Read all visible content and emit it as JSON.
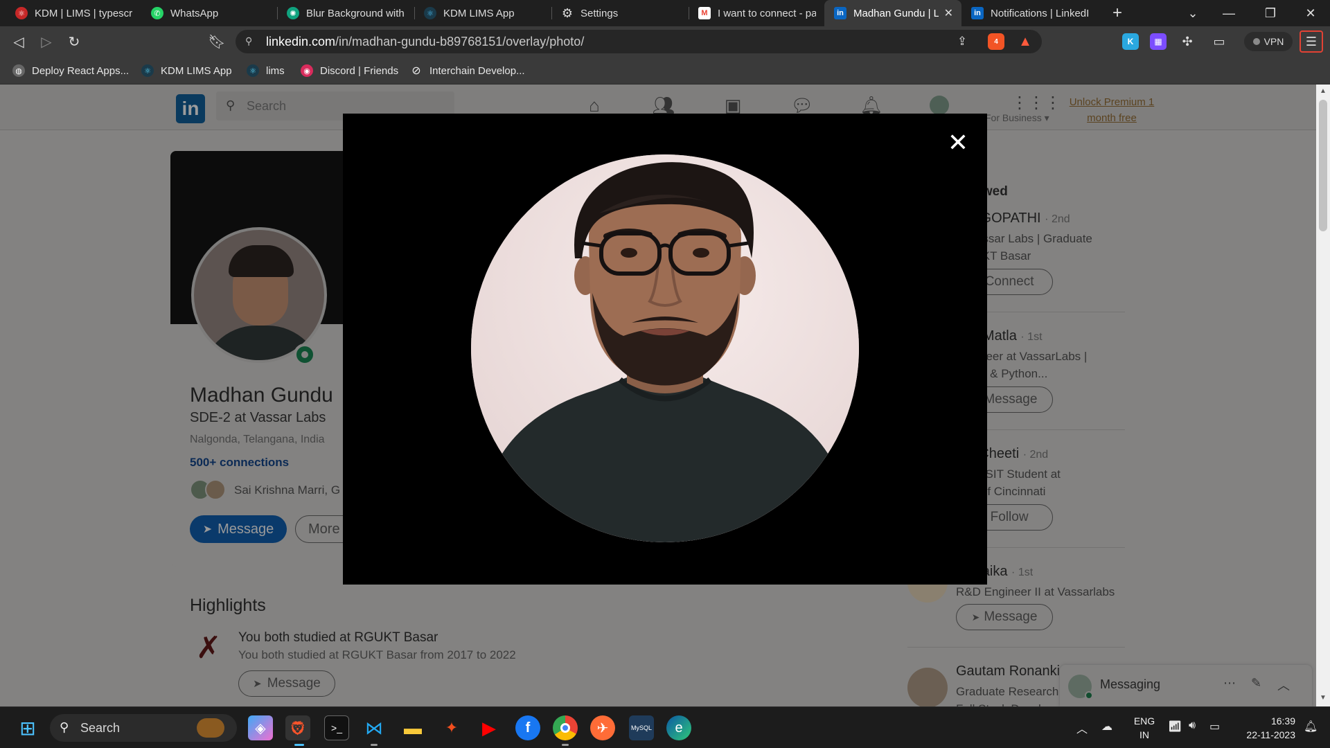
{
  "browser": {
    "tabs": [
      {
        "title": "KDM | LIMS | typescript",
        "icon": "react-icon",
        "color": "#c62828"
      },
      {
        "title": "WhatsApp",
        "icon": "whatsapp-icon",
        "color": "#25d366"
      },
      {
        "title": "Blur Background with C",
        "icon": "openai-icon",
        "color": "#10a37f"
      },
      {
        "title": "KDM LIMS App",
        "icon": "react-icon",
        "color": "#4fc3f7"
      },
      {
        "title": "Settings",
        "icon": "gear-icon",
        "color": "#bdbdbd"
      },
      {
        "title": "I want to connect - pav",
        "icon": "gmail-icon",
        "color": "#ea4335"
      },
      {
        "title": "Madhan Gundu | L",
        "icon": "linkedin-icon",
        "color": "#0a66c2"
      },
      {
        "title": "Notifications | LinkedIn",
        "icon": "linkedin-icon",
        "color": "#0a66c2"
      }
    ],
    "new_tab_label": "+",
    "url_host": "linkedin.com",
    "url_path": "/in/madhan-gundu-b89768151/overlay/photo/",
    "vpn_label": "VPN",
    "brave_badge": "4",
    "bookmarks": [
      {
        "label": "Deploy React Apps...",
        "icon": "globe-icon"
      },
      {
        "label": "KDM LIMS App",
        "icon": "react-icon"
      },
      {
        "label": "lims",
        "icon": "react-icon"
      },
      {
        "label": "Discord | Friends",
        "icon": "discord-icon"
      },
      {
        "label": "Interchain Develop...",
        "icon": "slashed-circle-icon"
      }
    ]
  },
  "linkedin": {
    "search_placeholder": "Search",
    "for_business": "For Business",
    "premium_line1": "Unlock Premium 1",
    "premium_line2": "month free",
    "profile": {
      "name": "Madhan Gundu",
      "headline": "SDE-2 at Vassar Labs",
      "location": "Nalgonda, Telangana, India",
      "connections": "500+ connections",
      "mutual": "Sai Krishna Marri, G",
      "message_btn": "Message",
      "more_btn": "More"
    },
    "highlights": {
      "title": "Highlights",
      "heading": "You both studied at RGUKT Basar",
      "sub": "You both studied at RGUKT Basar from 2017 to 2022",
      "button": "Message"
    },
    "people_viewed": {
      "title": "iewed",
      "items": [
        {
          "name": "AM GOPATHI",
          "degree": "· 2nd",
          "line1": "at Vassar Labs | Graduate",
          "line2": "RGUKT Basar",
          "button": "Connect"
        },
        {
          "name": "eep Matla",
          "degree": "· 1st",
          "line1": "Engineer at VassarLabs |",
          "line2": "gBoot & Python...",
          "button": "Message"
        },
        {
          "name": "tha Cheeti",
          "degree": "· 2nd",
          "line1": "ate MSIT Student at",
          "line2": "rsity of Cincinnati",
          "button": "Follow"
        },
        {
          "name": "ar Naika",
          "degree": "· 1st",
          "line1": "R&D Engineer II at Vassarlabs",
          "line2": "",
          "button": "Message"
        },
        {
          "name": "Gautam Ronanki",
          "degree": "",
          "line1": "Graduate Research",
          "line2": "Full Stack Develo",
          "button": ""
        }
      ]
    },
    "messaging_label": "Messaging"
  },
  "taskbar": {
    "search_label": "Search",
    "lang_line1": "ENG",
    "lang_line2": "IN",
    "time": "16:39",
    "date": "22-11-2023"
  }
}
